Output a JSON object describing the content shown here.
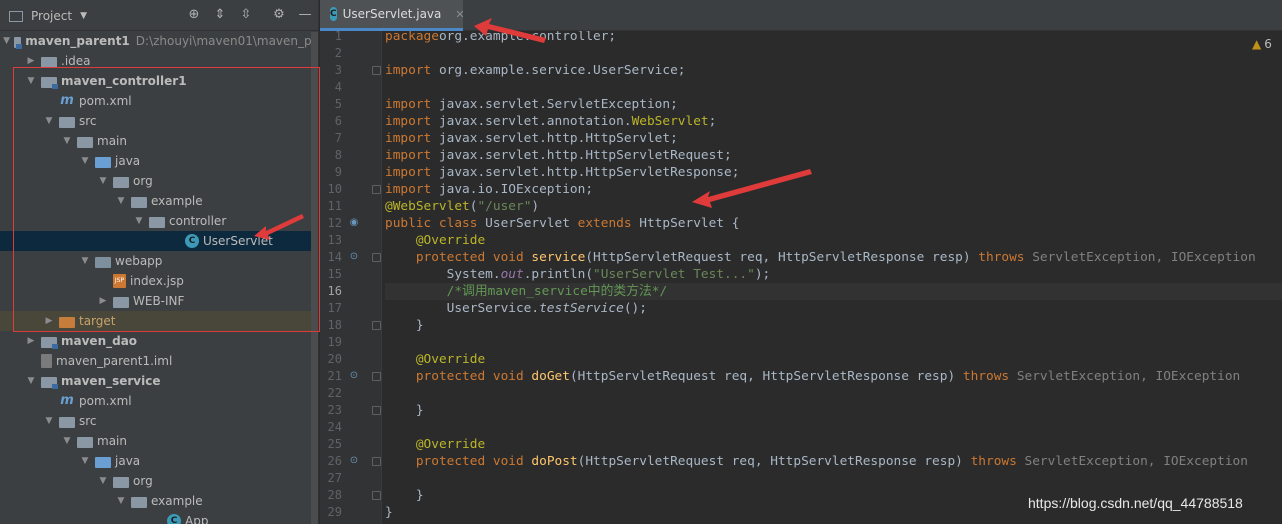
{
  "project_panel": {
    "title": "Project",
    "tree": [
      {
        "label": "maven_parent1",
        "path": "D:\\zhouyi\\maven01\\maven_pa",
        "bold": true,
        "icon": "module-folder-icon",
        "indent": 0,
        "arrow": "down"
      },
      {
        "label": ".idea",
        "icon": "folder-icon",
        "indent": 1,
        "arrow": "right"
      },
      {
        "label": "maven_controller1",
        "bold": true,
        "icon": "module-folder-icon",
        "indent": 1,
        "arrow": "down"
      },
      {
        "label": "pom.xml",
        "icon": "maven-icon",
        "indent": 2,
        "arrow": ""
      },
      {
        "label": "src",
        "icon": "folder-icon",
        "indent": 2,
        "arrow": "down"
      },
      {
        "label": "main",
        "icon": "folder-icon",
        "indent": 3,
        "arrow": "down"
      },
      {
        "label": "java",
        "icon": "source-folder-icon",
        "indent": 4,
        "arrow": "down"
      },
      {
        "label": "org",
        "icon": "package-icon",
        "indent": 5,
        "arrow": "down"
      },
      {
        "label": "example",
        "icon": "package-icon",
        "indent": 6,
        "arrow": "down"
      },
      {
        "label": "controller",
        "icon": "package-icon",
        "indent": 7,
        "arrow": "down"
      },
      {
        "label": "UserServlet",
        "icon": "class-icon",
        "indent": 9,
        "arrow": "",
        "selected": true
      },
      {
        "label": "webapp",
        "icon": "web-folder-icon",
        "indent": 4,
        "arrow": "down"
      },
      {
        "label": "index.jsp",
        "icon": "jsp-icon",
        "indent": 5,
        "arrow": ""
      },
      {
        "label": "WEB-INF",
        "icon": "folder-icon",
        "indent": 5,
        "arrow": "right"
      },
      {
        "label": "target",
        "icon": "excluded-folder-icon",
        "indent": 2,
        "arrow": "right",
        "highlight": true
      },
      {
        "label": "maven_dao",
        "bold": true,
        "icon": "module-folder-icon",
        "indent": 1,
        "arrow": "right"
      },
      {
        "label": "maven_parent1.iml",
        "icon": "iml-icon",
        "indent": 1,
        "arrow": ""
      },
      {
        "label": "maven_service",
        "bold": true,
        "icon": "module-folder-icon",
        "indent": 1,
        "arrow": "down"
      },
      {
        "label": "pom.xml",
        "icon": "maven-icon",
        "indent": 2,
        "arrow": ""
      },
      {
        "label": "src",
        "icon": "folder-icon",
        "indent": 2,
        "arrow": "down"
      },
      {
        "label": "main",
        "icon": "folder-icon",
        "indent": 3,
        "arrow": "down"
      },
      {
        "label": "java",
        "icon": "source-folder-icon",
        "indent": 4,
        "arrow": "down"
      },
      {
        "label": "org",
        "icon": "package-icon",
        "indent": 5,
        "arrow": "down"
      },
      {
        "label": "example",
        "icon": "package-icon",
        "indent": 6,
        "arrow": "down"
      },
      {
        "label": "App",
        "icon": "class-icon",
        "indent": 8,
        "arrow": ""
      }
    ]
  },
  "editor": {
    "tab_label": "UserServlet.java",
    "warning_count": "6",
    "current_line": 16,
    "lines": [
      {
        "n": 1,
        "tokens": [
          [
            "kw",
            "package"
          ],
          [
            "",
            "org.example.controller;"
          ]
        ]
      },
      {
        "n": 2,
        "tokens": []
      },
      {
        "n": 3,
        "tokens": [
          [
            "kw",
            "import "
          ],
          [
            "",
            "org.example.service.UserService;"
          ]
        ],
        "fold": true
      },
      {
        "n": 4,
        "tokens": []
      },
      {
        "n": 5,
        "tokens": [
          [
            "kw",
            "import "
          ],
          [
            "",
            "javax.servlet.ServletException;"
          ]
        ]
      },
      {
        "n": 6,
        "tokens": [
          [
            "kw",
            "import "
          ],
          [
            "",
            "javax.servlet.annotation."
          ],
          [
            "ann",
            "WebServlet"
          ],
          [
            "",
            ";"
          ]
        ]
      },
      {
        "n": 7,
        "tokens": [
          [
            "kw",
            "import "
          ],
          [
            "",
            "javax.servlet.http.HttpServlet;"
          ]
        ]
      },
      {
        "n": 8,
        "tokens": [
          [
            "kw",
            "import "
          ],
          [
            "",
            "javax.servlet.http.HttpServletRequest;"
          ]
        ]
      },
      {
        "n": 9,
        "tokens": [
          [
            "kw",
            "import "
          ],
          [
            "",
            "javax.servlet.http.HttpServletResponse;"
          ]
        ]
      },
      {
        "n": 10,
        "tokens": [
          [
            "kw",
            "import "
          ],
          [
            "",
            "java.io.IOException;"
          ]
        ],
        "fold": true
      },
      {
        "n": 11,
        "tokens": [
          [
            "ann",
            "@WebServlet"
          ],
          [
            "",
            "("
          ],
          [
            "str",
            "\"/user\""
          ],
          [
            "",
            ")"
          ]
        ]
      },
      {
        "n": 12,
        "tokens": [
          [
            "kw",
            "public class "
          ],
          [
            "",
            "UserServlet "
          ],
          [
            "kw",
            "extends "
          ],
          [
            "",
            "HttpServlet {"
          ]
        ],
        "gutter": "implemented-icon"
      },
      {
        "n": 13,
        "tokens": [
          [
            "",
            "    "
          ],
          [
            "ann",
            "@Override"
          ]
        ]
      },
      {
        "n": 14,
        "tokens": [
          [
            "",
            "    "
          ],
          [
            "kw",
            "protected void "
          ],
          [
            "fn",
            "service"
          ],
          [
            "",
            "(HttpServletRequest req, HttpServletResponse resp) "
          ],
          [
            "kw",
            "throws "
          ],
          [
            "gray",
            "ServletException, IOException"
          ]
        ],
        "gutter": "override-icon",
        "fold": true
      },
      {
        "n": 15,
        "tokens": [
          [
            "",
            "        System."
          ],
          [
            "st",
            "out"
          ],
          [
            "",
            ".println("
          ],
          [
            "str",
            "\"UserServlet Test...\""
          ],
          [
            "",
            ");"
          ]
        ]
      },
      {
        "n": 16,
        "tokens": [
          [
            "",
            "        "
          ],
          [
            "cmt",
            "/*调用maven_service中的类方法*/"
          ]
        ]
      },
      {
        "n": 17,
        "tokens": [
          [
            "",
            "        UserService."
          ],
          [
            "it",
            "testService"
          ],
          [
            "",
            "();"
          ]
        ]
      },
      {
        "n": 18,
        "tokens": [
          [
            "",
            "    }"
          ]
        ],
        "fold": true
      },
      {
        "n": 19,
        "tokens": []
      },
      {
        "n": 20,
        "tokens": [
          [
            "",
            "    "
          ],
          [
            "ann",
            "@Override"
          ]
        ]
      },
      {
        "n": 21,
        "tokens": [
          [
            "",
            "    "
          ],
          [
            "kw",
            "protected void "
          ],
          [
            "fn",
            "doGet"
          ],
          [
            "",
            "(HttpServletRequest req, HttpServletResponse resp) "
          ],
          [
            "kw",
            "throws "
          ],
          [
            "gray",
            "ServletException, IOException"
          ]
        ],
        "gutter": "override-icon",
        "fold": true
      },
      {
        "n": 22,
        "tokens": []
      },
      {
        "n": 23,
        "tokens": [
          [
            "",
            "    }"
          ]
        ],
        "fold": true
      },
      {
        "n": 24,
        "tokens": []
      },
      {
        "n": 25,
        "tokens": [
          [
            "",
            "    "
          ],
          [
            "ann",
            "@Override"
          ]
        ]
      },
      {
        "n": 26,
        "tokens": [
          [
            "",
            "    "
          ],
          [
            "kw",
            "protected void "
          ],
          [
            "fn",
            "doPost"
          ],
          [
            "",
            "(HttpServletRequest req, HttpServletResponse resp) "
          ],
          [
            "kw",
            "throws "
          ],
          [
            "gray",
            "ServletException, IOException"
          ]
        ],
        "gutter": "override-icon",
        "fold": true
      },
      {
        "n": 27,
        "tokens": []
      },
      {
        "n": 28,
        "tokens": [
          [
            "",
            "    }"
          ]
        ],
        "fold": true
      },
      {
        "n": 29,
        "tokens": [
          [
            "",
            "}"
          ]
        ]
      },
      {
        "n": 30,
        "tokens": []
      }
    ]
  },
  "watermark": "https://blog.csdn.net/qq_44788518",
  "colors": {
    "annotation_red": "#e03b3b",
    "selection": "#0d293e",
    "accent": "#4a88c7"
  }
}
